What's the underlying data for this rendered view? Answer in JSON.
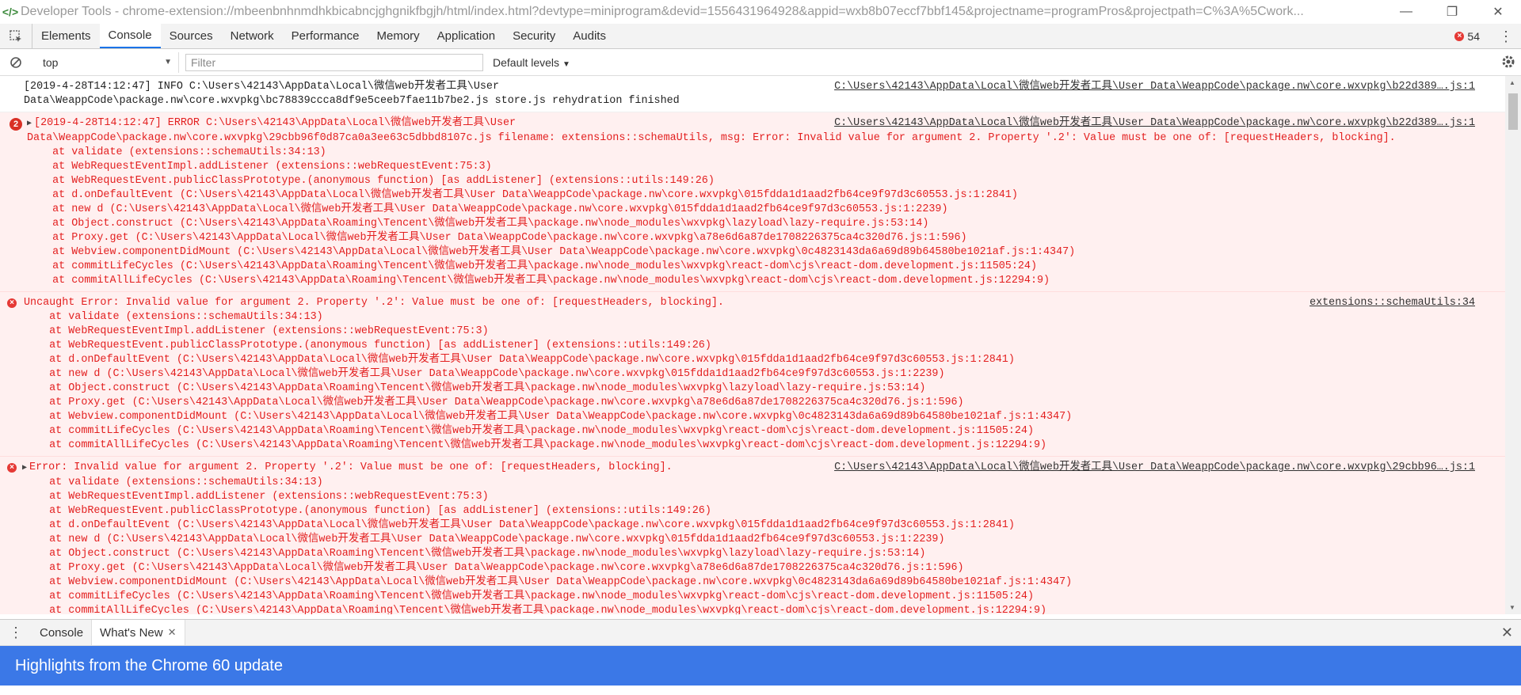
{
  "window": {
    "title": "Developer Tools - chrome-extension://mbeenbnhnmdhkbicabncjghgnikfbgjh/html/index.html?devtype=miniprogram&devid=1556431964928&appid=wxb8b07eccf7bbf145&projectname=programPros&projectpath=C%3A%5Cwork...",
    "logo": "</>"
  },
  "tabs": [
    "Elements",
    "Console",
    "Sources",
    "Network",
    "Performance",
    "Memory",
    "Application",
    "Security",
    "Audits"
  ],
  "active_tab": "Console",
  "error_count": "54",
  "console_toolbar": {
    "context": "top",
    "filter_placeholder": "Filter",
    "levels": "Default levels"
  },
  "messages": [
    {
      "type": "info",
      "lines": [
        "[2019-4-28T14:12:47] INFO C:\\Users\\42143\\AppData\\Local\\微信web开发者工具\\User",
        "Data\\WeappCode\\package.nw\\core.wxvpkg\\bc78839ccca8df9e5ceeb7fae11b7be2.js store.js rehydration finished"
      ],
      "source": "C:\\Users\\42143\\AppData\\Local\\微信web开发者工具\\User Data\\WeappCode\\package.nw\\core.wxvpkg\\b22d389….js:1"
    },
    {
      "type": "error",
      "badge": "2",
      "lines": [
        "[2019-4-28T14:12:47] ERROR C:\\Users\\42143\\AppData\\Local\\微信web开发者工具\\User",
        "Data\\WeappCode\\package.nw\\core.wxvpkg\\29cbb96f0d87ca0a3ee63c5dbbd8107c.js filename: extensions::schemaUtils, msg: Error: Invalid value for argument 2. Property '.2': Value must be one of: [requestHeaders, blocking].",
        "    at validate (extensions::schemaUtils:34:13)",
        "    at WebRequestEventImpl.addListener (extensions::webRequestEvent:75:3)",
        "    at WebRequestEvent.publicClassPrototype.(anonymous function) [as addListener] (extensions::utils:149:26)",
        "    at d.onDefaultEvent (C:\\Users\\42143\\AppData\\Local\\微信web开发者工具\\User Data\\WeappCode\\package.nw\\core.wxvpkg\\015fdda1d1aad2fb64ce9f97d3c60553.js:1:2841)",
        "    at new d (C:\\Users\\42143\\AppData\\Local\\微信web开发者工具\\User Data\\WeappCode\\package.nw\\core.wxvpkg\\015fdda1d1aad2fb64ce9f97d3c60553.js:1:2239)",
        "    at Object.construct (C:\\Users\\42143\\AppData\\Roaming\\Tencent\\微信web开发者工具\\package.nw\\node_modules\\wxvpkg\\lazyload\\lazy-require.js:53:14)",
        "    at Proxy.get (C:\\Users\\42143\\AppData\\Local\\微信web开发者工具\\User Data\\WeappCode\\package.nw\\core.wxvpkg\\a78e6d6a87de1708226375ca4c320d76.js:1:596)",
        "    at Webview.componentDidMount (C:\\Users\\42143\\AppData\\Local\\微信web开发者工具\\User Data\\WeappCode\\package.nw\\core.wxvpkg\\0c4823143da6a69d89b64580be1021af.js:1:4347)",
        "    at commitLifeCycles (C:\\Users\\42143\\AppData\\Roaming\\Tencent\\微信web开发者工具\\package.nw\\node_modules\\wxvpkg\\react-dom\\cjs\\react-dom.development.js:11505:24)",
        "    at commitAllLifeCycles (C:\\Users\\42143\\AppData\\Roaming\\Tencent\\微信web开发者工具\\package.nw\\node_modules\\wxvpkg\\react-dom\\cjs\\react-dom.development.js:12294:9)"
      ],
      "source": "C:\\Users\\42143\\AppData\\Local\\微信web开发者工具\\User Data\\WeappCode\\package.nw\\core.wxvpkg\\b22d389….js:1"
    },
    {
      "type": "error",
      "icon": "×",
      "lines": [
        "Uncaught Error: Invalid value for argument 2. Property '.2': Value must be one of: [requestHeaders, blocking].",
        "    at validate (extensions::schemaUtils:34:13)",
        "    at WebRequestEventImpl.addListener (extensions::webRequestEvent:75:3)",
        "    at WebRequestEvent.publicClassPrototype.(anonymous function) [as addListener] (extensions::utils:149:26)",
        "    at d.onDefaultEvent (C:\\Users\\42143\\AppData\\Local\\微信web开发者工具\\User Data\\WeappCode\\package.nw\\core.wxvpkg\\015fdda1d1aad2fb64ce9f97d3c60553.js:1:2841)",
        "    at new d (C:\\Users\\42143\\AppData\\Local\\微信web开发者工具\\User Data\\WeappCode\\package.nw\\core.wxvpkg\\015fdda1d1aad2fb64ce9f97d3c60553.js:1:2239)",
        "    at Object.construct (C:\\Users\\42143\\AppData\\Roaming\\Tencent\\微信web开发者工具\\package.nw\\node_modules\\wxvpkg\\lazyload\\lazy-require.js:53:14)",
        "    at Proxy.get (C:\\Users\\42143\\AppData\\Local\\微信web开发者工具\\User Data\\WeappCode\\package.nw\\core.wxvpkg\\a78e6d6a87de1708226375ca4c320d76.js:1:596)",
        "    at Webview.componentDidMount (C:\\Users\\42143\\AppData\\Local\\微信web开发者工具\\User Data\\WeappCode\\package.nw\\core.wxvpkg\\0c4823143da6a69d89b64580be1021af.js:1:4347)",
        "    at commitLifeCycles (C:\\Users\\42143\\AppData\\Roaming\\Tencent\\微信web开发者工具\\package.nw\\node_modules\\wxvpkg\\react-dom\\cjs\\react-dom.development.js:11505:24)",
        "    at commitAllLifeCycles (C:\\Users\\42143\\AppData\\Roaming\\Tencent\\微信web开发者工具\\package.nw\\node_modules\\wxvpkg\\react-dom\\cjs\\react-dom.development.js:12294:9)"
      ],
      "source": "extensions::schemaUtils:34"
    },
    {
      "type": "error",
      "icon": "×",
      "lines": [
        "Error: Invalid value for argument 2. Property '.2': Value must be one of: [requestHeaders, blocking].",
        "    at validate (extensions::schemaUtils:34:13)",
        "    at WebRequestEventImpl.addListener (extensions::webRequestEvent:75:3)",
        "    at WebRequestEvent.publicClassPrototype.(anonymous function) [as addListener] (extensions::utils:149:26)",
        "    at d.onDefaultEvent (C:\\Users\\42143\\AppData\\Local\\微信web开发者工具\\User Data\\WeappCode\\package.nw\\core.wxvpkg\\015fdda1d1aad2fb64ce9f97d3c60553.js:1:2841)",
        "    at new d (C:\\Users\\42143\\AppData\\Local\\微信web开发者工具\\User Data\\WeappCode\\package.nw\\core.wxvpkg\\015fdda1d1aad2fb64ce9f97d3c60553.js:1:2239)",
        "    at Object.construct (C:\\Users\\42143\\AppData\\Roaming\\Tencent\\微信web开发者工具\\package.nw\\node_modules\\wxvpkg\\lazyload\\lazy-require.js:53:14)",
        "    at Proxy.get (C:\\Users\\42143\\AppData\\Local\\微信web开发者工具\\User Data\\WeappCode\\package.nw\\core.wxvpkg\\a78e6d6a87de1708226375ca4c320d76.js:1:596)",
        "    at Webview.componentDidMount (C:\\Users\\42143\\AppData\\Local\\微信web开发者工具\\User Data\\WeappCode\\package.nw\\core.wxvpkg\\0c4823143da6a69d89b64580be1021af.js:1:4347)",
        "    at commitLifeCycles (C:\\Users\\42143\\AppData\\Roaming\\Tencent\\微信web开发者工具\\package.nw\\node_modules\\wxvpkg\\react-dom\\cjs\\react-dom.development.js:11505:24)",
        "    at commitAllLifeCycles (C:\\Users\\42143\\AppData\\Roaming\\Tencent\\微信web开发者工具\\package.nw\\node_modules\\wxvpkg\\react-dom\\cjs\\react-dom.development.js:12294:9)"
      ],
      "source": "C:\\Users\\42143\\AppData\\Local\\微信web开发者工具\\User Data\\WeappCode\\package.nw\\core.wxvpkg\\29cbb96….js:1"
    }
  ],
  "drawer": {
    "tabs": [
      "Console",
      "What's New"
    ],
    "active": "What's New",
    "banner": "Highlights from the Chrome 60 update"
  },
  "colors": {
    "error_bg": "#fff0f0",
    "error_text": "#e31f1f",
    "banner": "#3b78e7",
    "tab_underline": "#1a73e8"
  }
}
